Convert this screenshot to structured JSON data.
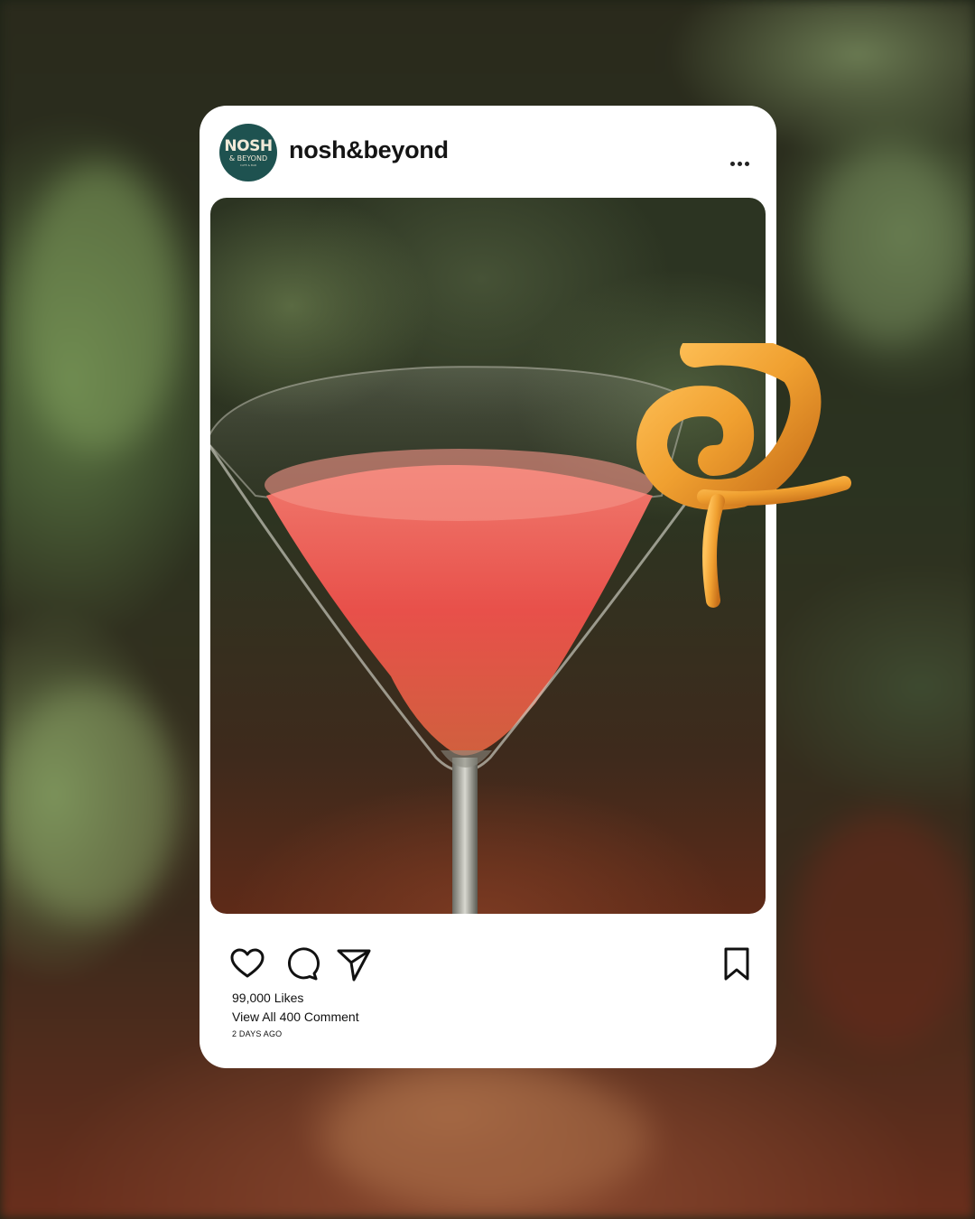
{
  "post": {
    "username": "nosh&beyond",
    "avatar": {
      "line1": "NOSH",
      "line2": "& BEYOND",
      "line3": "CAFÉ & BAR",
      "color": "#1e5250"
    },
    "menu_icon": "more-horizontal-icon",
    "image_subject": "cocktail-martini-glass-with-orange-peel",
    "likes_text": "99,000 Likes",
    "comments_text": "View All 400 Comment",
    "time_text": "2 DAYS AGO"
  },
  "actions": {
    "like_icon": "heart-icon",
    "comment_icon": "comment-icon",
    "share_icon": "send-icon",
    "save_icon": "bookmark-icon"
  },
  "colors": {
    "card": "#ffffff",
    "text": "#141414",
    "drink": "#e8504a",
    "peel": "#f0a030"
  }
}
